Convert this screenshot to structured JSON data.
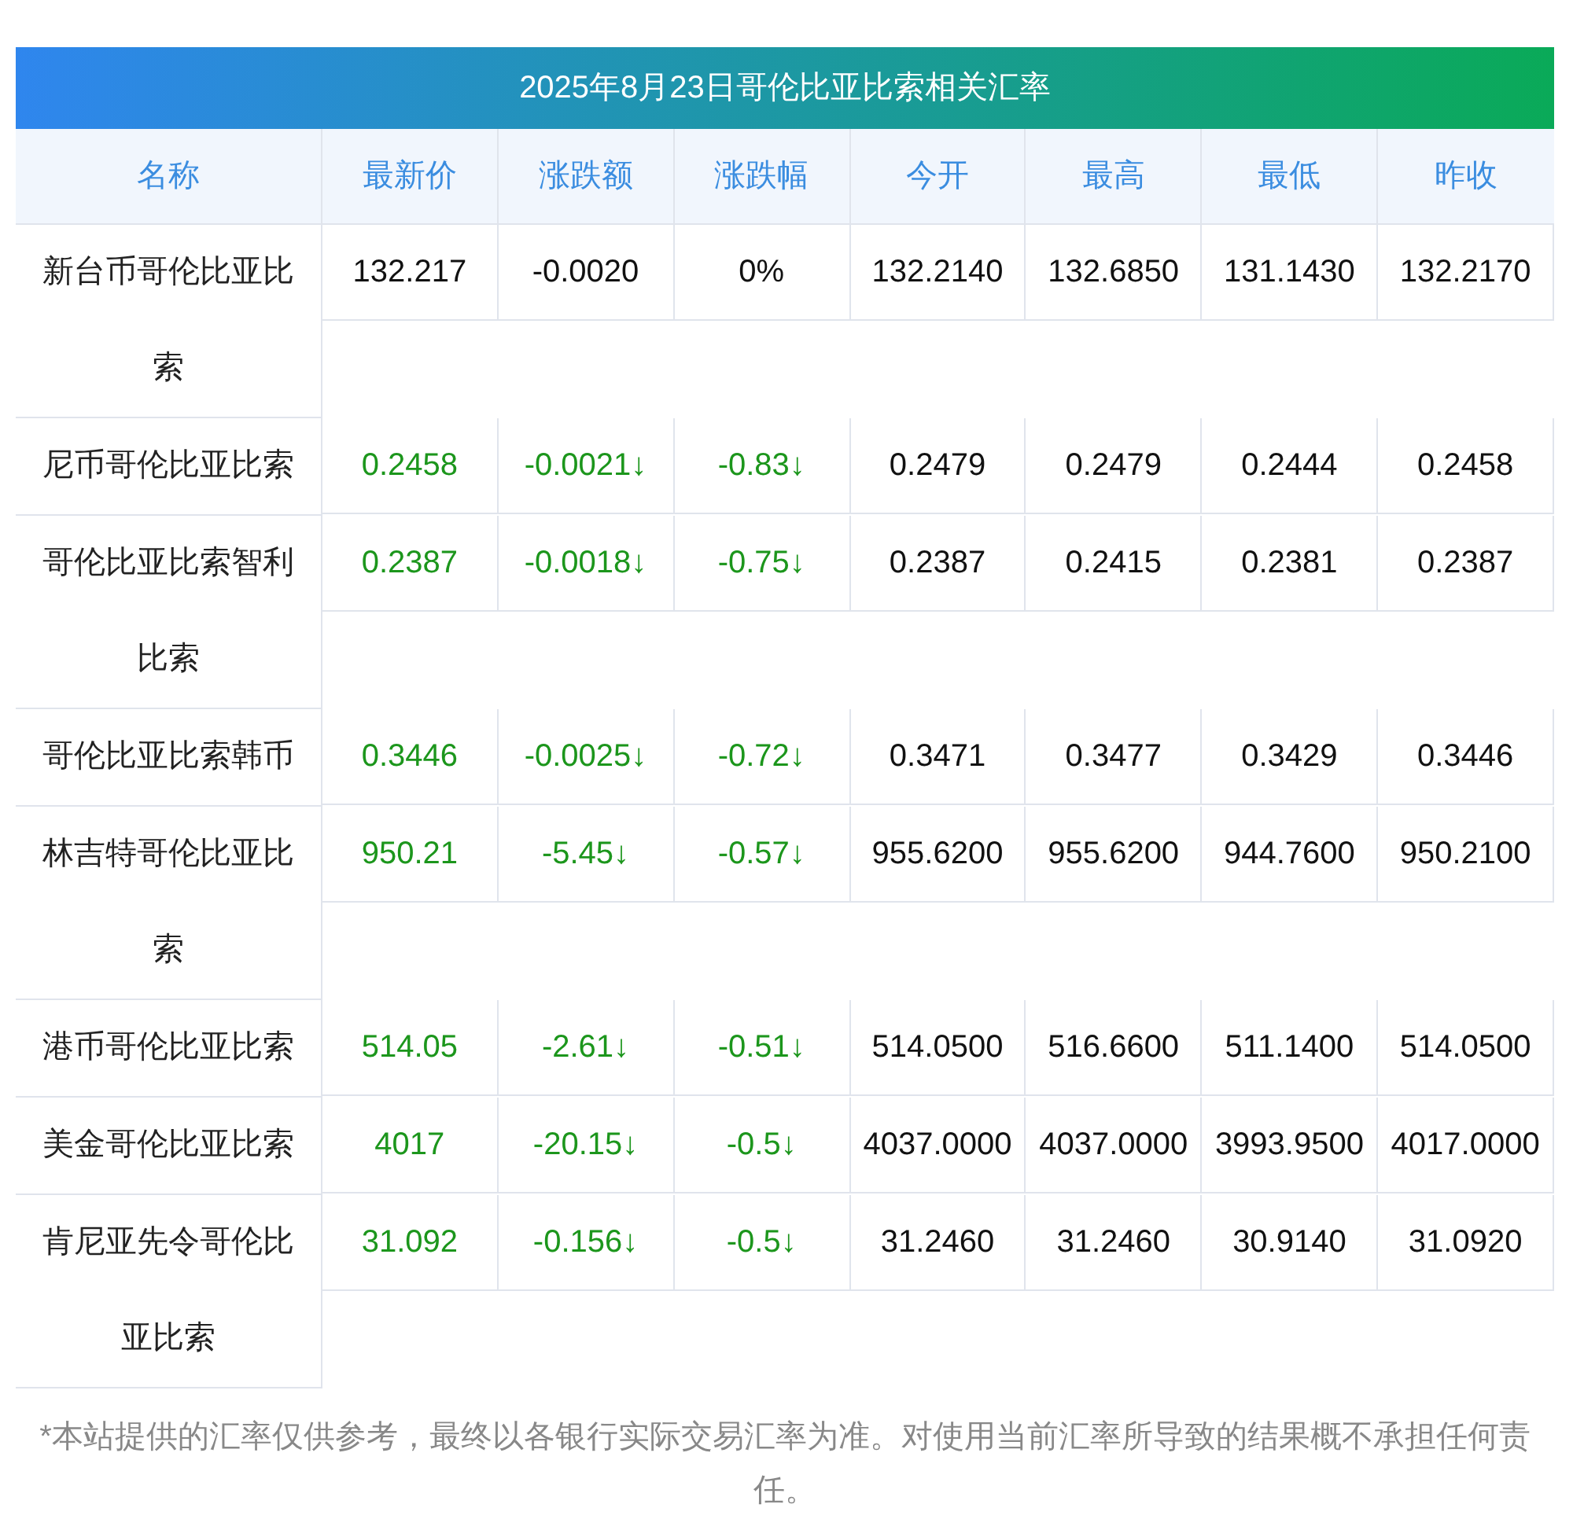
{
  "title": "2025年8月23日哥伦比亚比索相关汇率",
  "columns": [
    "名称",
    "最新价",
    "涨跌额",
    "涨跌幅",
    "今开",
    "最高",
    "最低",
    "昨收"
  ],
  "rows": [
    {
      "name": "新台币哥伦比亚比索",
      "color": "#111111",
      "latest": "132.217",
      "change": "-0.0020",
      "change_pct": "0%",
      "open": "132.2140",
      "high": "132.6850",
      "low": "131.1430",
      "prev_close": "132.2170"
    },
    {
      "name": "尼币哥伦比亚比索",
      "color": "#1c961c",
      "latest": "0.2458",
      "change": "-0.0021↓",
      "change_pct": "-0.83↓",
      "open": "0.2479",
      "high": "0.2479",
      "low": "0.2444",
      "prev_close": "0.2458"
    },
    {
      "name": "哥伦比亚比索智利比索",
      "color": "#1c961c",
      "latest": "0.2387",
      "change": "-0.0018↓",
      "change_pct": "-0.75↓",
      "open": "0.2387",
      "high": "0.2415",
      "low": "0.2381",
      "prev_close": "0.2387"
    },
    {
      "name": "哥伦比亚比索韩币",
      "color": "#1c961c",
      "latest": "0.3446",
      "change": "-0.0025↓",
      "change_pct": "-0.72↓",
      "open": "0.3471",
      "high": "0.3477",
      "low": "0.3429",
      "prev_close": "0.3446"
    },
    {
      "name": "林吉特哥伦比亚比索",
      "color": "#1c961c",
      "latest": "950.21",
      "change": "-5.45↓",
      "change_pct": "-0.57↓",
      "open": "955.6200",
      "high": "955.6200",
      "low": "944.7600",
      "prev_close": "950.2100"
    },
    {
      "name": "港币哥伦比亚比索",
      "color": "#1c961c",
      "latest": "514.05",
      "change": "-2.61↓",
      "change_pct": "-0.51↓",
      "open": "514.0500",
      "high": "516.6600",
      "low": "511.1400",
      "prev_close": "514.0500"
    },
    {
      "name": "美金哥伦比亚比索",
      "color": "#1c961c",
      "latest": "4017",
      "change": "-20.15↓",
      "change_pct": "-0.5↓",
      "open": "4037.0000",
      "high": "4037.0000",
      "low": "3993.9500",
      "prev_close": "4017.0000"
    },
    {
      "name": "肯尼亚先令哥伦比亚比索",
      "color": "#1c961c",
      "latest": "31.092",
      "change": "-0.156↓",
      "change_pct": "-0.5↓",
      "open": "31.2460",
      "high": "31.2460",
      "low": "30.9140",
      "prev_close": "31.0920"
    }
  ],
  "disclaimer": "*本站提供的汇率仅供参考，最终以各银行实际交易汇率为准。对使用当前汇率所导致的结果概不承担任何责任。"
}
